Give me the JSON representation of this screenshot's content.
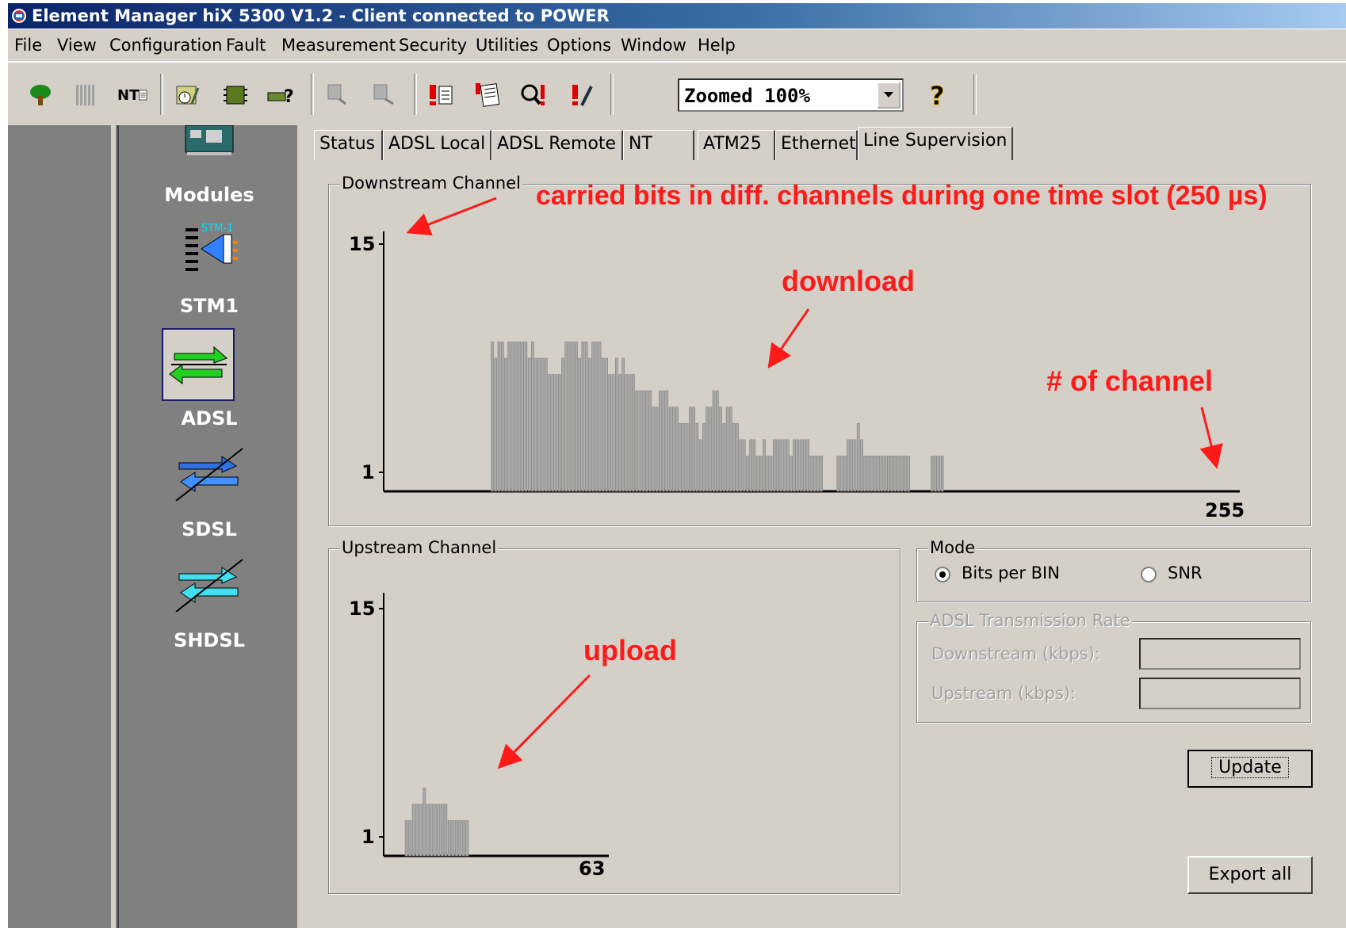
{
  "window": {
    "title": "Element Manager hiX 5300 V1.2 - Client connected to POWER"
  },
  "menu": [
    "File",
    "View",
    "Configuration",
    "Fault",
    "Measurement",
    "Security",
    "Utilities",
    "Options",
    "Window",
    "Help"
  ],
  "toolbar": {
    "icons": [
      "tree-icon",
      "rack-icon",
      "nt-icon",
      "schedule-icon",
      "board-icon",
      "query-icon",
      "zoom-out-icon",
      "zoom-in-icon",
      "alarm-list-icon",
      "alarm-log-icon",
      "alarm-search-icon",
      "alarm-edit-icon",
      "help-icon"
    ],
    "zoom_value": "Zoomed 100%",
    "nt_label": "NT"
  },
  "sidebar": {
    "section_title": "Modules",
    "modules": [
      {
        "label": "STM1",
        "icon": "stm1-icon",
        "icon_text": "STM-1"
      },
      {
        "label": "ADSL",
        "icon": "adsl-icon",
        "selected": true
      },
      {
        "label": "SDSL",
        "icon": "sdsl-icon"
      },
      {
        "label": "SHDSL",
        "icon": "shdsl-icon"
      }
    ]
  },
  "tabs": [
    "Status",
    "ADSL Local",
    "ADSL Remote",
    "NT",
    "ATM25",
    "Ethernet",
    "Line Supervision"
  ],
  "active_tab": "Line Supervision",
  "downstream": {
    "title": "Downstream Channel",
    "y_top": "15",
    "y_bottom": "1",
    "x_end": "255"
  },
  "upstream": {
    "title": "Upstream Channel",
    "y_top": "15",
    "y_bottom": "1",
    "x_end": "63"
  },
  "mode": {
    "title": "Mode",
    "option1": "Bits per BIN",
    "option2": "SNR",
    "selected": "Bits per BIN"
  },
  "rate": {
    "title": "ADSL Transmission Rate",
    "downstream_label": "Downstream (kbps):",
    "upstream_label": "Upstream (kbps):",
    "downstream_value": "",
    "upstream_value": ""
  },
  "buttons": {
    "update": "Update",
    "export": "Export all"
  },
  "annotations": {
    "carried_bits": "carried bits in diff. channels during one time slot (250 µs)",
    "download": "download",
    "channel_count": "# of channel",
    "upload": "upload"
  },
  "colors": {
    "annotation": "#ff1a1a",
    "title_start": "#0a246a",
    "bars": "#a8a8a8"
  },
  "chart_data": [
    {
      "type": "bar",
      "title": "Downstream Channel",
      "xlabel": "",
      "ylabel": "",
      "xlim": [
        0,
        255
      ],
      "ylim": [
        1,
        15
      ],
      "x_start": 32,
      "values": [
        9,
        8,
        9,
        9,
        8,
        9,
        9,
        9,
        9,
        9,
        9,
        8,
        9,
        8,
        8,
        8,
        8,
        7,
        7,
        7,
        7,
        8,
        9,
        9,
        9,
        9,
        8,
        9,
        9,
        8,
        9,
        9,
        9,
        8,
        8,
        7,
        7,
        8,
        7,
        8,
        7,
        7,
        7,
        6,
        6,
        6,
        6,
        6,
        5,
        5,
        6,
        6,
        6,
        5,
        5,
        5,
        4,
        4,
        4,
        5,
        5,
        4,
        3,
        4,
        5,
        5,
        6,
        6,
        5,
        4,
        5,
        5,
        4,
        4,
        3,
        3,
        2,
        3,
        3,
        2,
        2,
        3,
        2,
        2,
        3,
        3,
        3,
        3,
        3,
        2,
        3,
        3,
        3,
        3,
        3,
        2,
        2,
        2,
        2,
        0,
        0,
        0,
        0,
        2,
        2,
        2,
        3,
        3,
        3,
        4,
        3,
        2,
        2,
        2,
        2,
        2,
        2,
        2,
        2,
        2,
        2,
        2,
        2,
        2,
        2,
        0,
        0,
        0,
        0,
        0,
        0,
        2,
        2,
        2,
        2
      ]
    },
    {
      "type": "bar",
      "title": "Upstream Channel",
      "xlabel": "",
      "ylabel": "",
      "xlim": [
        0,
        63
      ],
      "ylim": [
        1,
        15
      ],
      "x_start": 6,
      "values": [
        2,
        2,
        3,
        3,
        3,
        4,
        3,
        3,
        3,
        3,
        3,
        3,
        2,
        2,
        2,
        2,
        2,
        2
      ]
    }
  ]
}
